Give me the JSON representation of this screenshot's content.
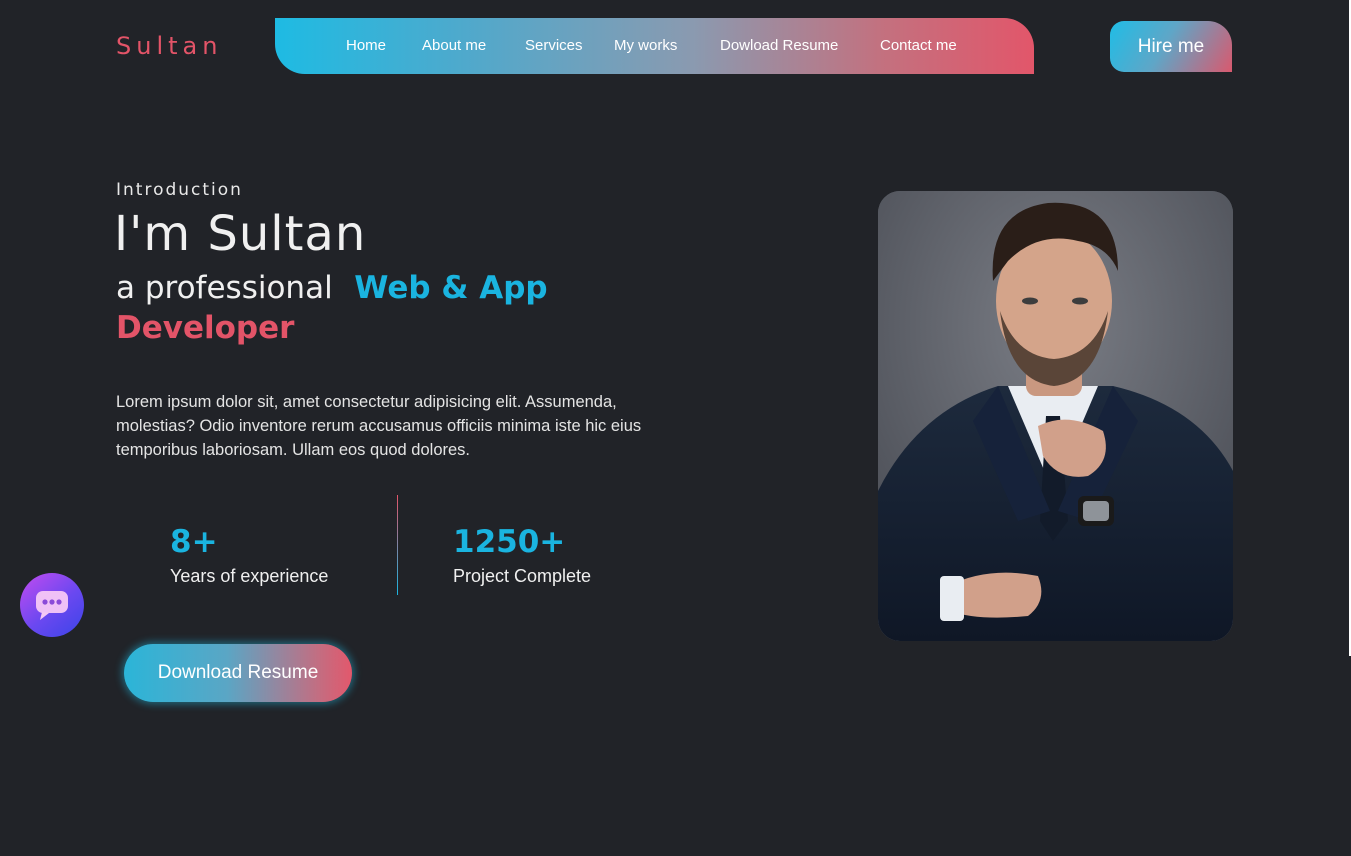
{
  "brand": {
    "logo_text": "Sultan"
  },
  "nav": {
    "items": [
      {
        "label": "Home"
      },
      {
        "label": "About me"
      },
      {
        "label": "Services"
      },
      {
        "label": "My works"
      },
      {
        "label": "Dowload Resume"
      },
      {
        "label": "Contact me"
      }
    ]
  },
  "header": {
    "hire_label": "Hire me"
  },
  "hero": {
    "intro": "Introduction",
    "name": "I'm Sultan",
    "sub_prefix": "a professional",
    "sub_blue": "Web & App",
    "sub_red": "Developer",
    "description": "Lorem ipsum dolor sit, amet consectetur adipisicing elit. Assumenda, molestias? Odio inventore rerum accusamus officiis minima iste hic eius temporibus laboriosam. Ullam eos quod dolores."
  },
  "stats": [
    {
      "value": "8+",
      "label": "Years of experience"
    },
    {
      "value": "1250+",
      "label": "Project Complete"
    }
  ],
  "cta": {
    "download_label": "Download Resume"
  },
  "icons": {
    "chat": "chat-bubble-icon"
  },
  "colors": {
    "background": "#212328",
    "accent_blue": "#1ab4e0",
    "accent_red": "#e35468"
  }
}
